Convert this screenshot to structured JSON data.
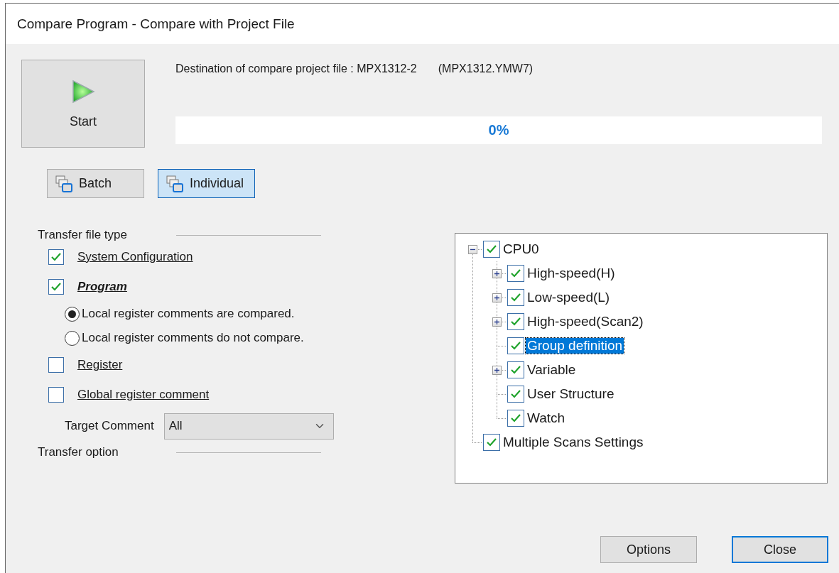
{
  "window": {
    "title": "Compare Program - Compare with Project File"
  },
  "start_button": {
    "label": "Start"
  },
  "destination": {
    "label": "Destination of compare project file :",
    "project": "MPX1312-2",
    "file": "(MPX1312.YMW7)"
  },
  "progress": {
    "reading": "0%"
  },
  "mode_buttons": [
    {
      "label": "Batch",
      "selected": false
    },
    {
      "label": "Individual",
      "selected": true
    }
  ],
  "transfer_file_type": {
    "heading": "Transfer file type",
    "items": [
      {
        "kind": "checkbox",
        "label": "System Configuration",
        "checked": true,
        "emphasized": false
      },
      {
        "kind": "checkbox",
        "label": "Program",
        "checked": true,
        "emphasized": true
      },
      {
        "kind": "radio",
        "label": "Local register comments are compared.",
        "selected": true
      },
      {
        "kind": "radio",
        "label": "Local register comments do not compare.",
        "selected": false
      },
      {
        "kind": "checkbox",
        "label": "Register",
        "checked": false,
        "emphasized": false
      },
      {
        "kind": "checkbox",
        "label": "Global register comment",
        "checked": false,
        "emphasized": false
      },
      {
        "kind": "dropdown",
        "label": "Target Comment",
        "value": "All"
      }
    ]
  },
  "transfer_option": {
    "heading": "Transfer option"
  },
  "tree": {
    "items": [
      {
        "label": "CPU0",
        "checked": true,
        "selected": false,
        "expanded": true,
        "children": [
          {
            "label": "High-speed(H)",
            "checked": true,
            "selected": false,
            "expanded": false
          },
          {
            "label": "Low-speed(L)",
            "checked": true,
            "selected": false,
            "expanded": false
          },
          {
            "label": "High-speed(Scan2)",
            "checked": true,
            "selected": false,
            "expanded": false
          },
          {
            "label": "Group definition",
            "checked": true,
            "selected": true
          },
          {
            "label": "Variable",
            "checked": true,
            "selected": false,
            "expanded": false
          },
          {
            "label": "User Structure",
            "checked": true,
            "selected": false
          },
          {
            "label": "Watch",
            "checked": true,
            "selected": false
          }
        ]
      },
      {
        "label": "Multiple Scans Settings",
        "checked": true,
        "selected": false
      }
    ]
  },
  "buttons": [
    {
      "label": "Options",
      "default": false
    },
    {
      "label": "Close",
      "default": true
    }
  ]
}
